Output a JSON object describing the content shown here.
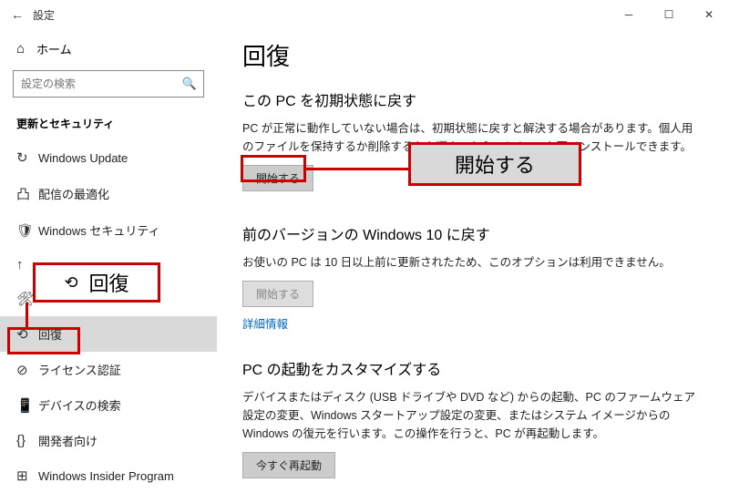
{
  "titlebar": {
    "back": "←",
    "title": "設定"
  },
  "sidebar": {
    "home_icon": "⌂",
    "home_label": "ホーム",
    "search_placeholder": "設定の検索",
    "section": "更新とセキュリティ",
    "items": [
      {
        "icon": "↻",
        "label": "Windows Update"
      },
      {
        "icon": "凸",
        "label": "配信の最適化"
      },
      {
        "icon": "🛡",
        "label": "Windows セキュリティ"
      },
      {
        "icon": "↑",
        "label": ""
      },
      {
        "icon": "🛠",
        "label": ""
      },
      {
        "icon": "⟲",
        "label": "回復"
      },
      {
        "icon": "⊘",
        "label": "ライセンス認証"
      },
      {
        "icon": "📱",
        "label": "デバイスの検索"
      },
      {
        "icon": "{}",
        "label": "開発者向け"
      },
      {
        "icon": "⊞",
        "label": "Windows Insider Program"
      }
    ]
  },
  "main": {
    "heading": "回復",
    "reset": {
      "title": "この PC を初期状態に戻す",
      "desc": "PC が正常に動作していない場合は、初期状態に戻すと解決する場合があります。個人用のファイルを保持するか削除するかを選んでから Windows を再インストールできます。",
      "button": "開始する"
    },
    "goback": {
      "title": "前のバージョンの Windows 10 に戻す",
      "desc": "お使いの PC は 10 日以上前に更新されたため、このオプションは利用できません。",
      "button": "開始する",
      "link": "詳細情報"
    },
    "advanced": {
      "title": "PC の起動をカスタマイズする",
      "desc": "デバイスまたはディスク (USB ドライブや DVD など) からの起動、PC のファームウェア設定の変更、Windows スタートアップ設定の変更、またはシステム イメージからの Windows の復元を行います。この操作を行うと、PC が再起動します。",
      "button": "今すぐ再起動"
    }
  },
  "annotations": {
    "callout_recovery": "回復",
    "callout_start": "開始する"
  }
}
